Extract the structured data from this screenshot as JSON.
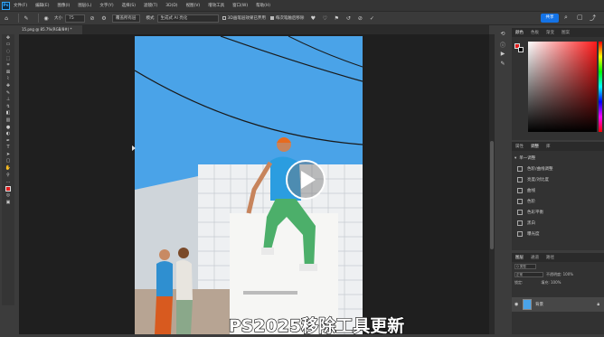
{
  "menubar": {
    "app_logo": "Ps",
    "items": [
      "文件(F)",
      "编辑(E)",
      "图像(I)",
      "图层(L)",
      "文字(Y)",
      "选择(S)",
      "滤镜(T)",
      "3D(D)",
      "视图(V)",
      "增效工具",
      "窗口(W)",
      "帮助(H)"
    ]
  },
  "options": {
    "size_label": "大小",
    "size_value": "75",
    "sample_all": "覆盖所有层",
    "mode_label": "模式",
    "mode_value": "生成式 AI 亮化",
    "check1": "3D画笔层效果已弃用",
    "check2": "每次笔触后移除",
    "share_label": "共享"
  },
  "document": {
    "tab_title": "15.png @ 85.7%(RGB/8#) *"
  },
  "panels": {
    "color_tabs": [
      "颜色",
      "色板",
      "渐变",
      "图案"
    ],
    "adjust_tabs": [
      "属性",
      "调整",
      "库"
    ],
    "adjust_header": "单一调整",
    "adjust_items": [
      "色阶/曲线调整",
      "亮度/对比度",
      "曲线",
      "色阶",
      "色彩平衡",
      "黑白",
      "曝光度"
    ],
    "layers_tabs": [
      "图层",
      "通道",
      "路径"
    ],
    "layers_kind": "Q 类型",
    "layers_mode": "正常",
    "layers_opacity": "不透明度: 100%",
    "layers_lock": "锁定:",
    "layers_fill": "填充: 100%",
    "layer_name": "背景"
  },
  "caption": "PS2025移除工具更新",
  "colors": {
    "foreground": "#e11d1d",
    "background": "#000000",
    "accent": "#1473e6"
  }
}
